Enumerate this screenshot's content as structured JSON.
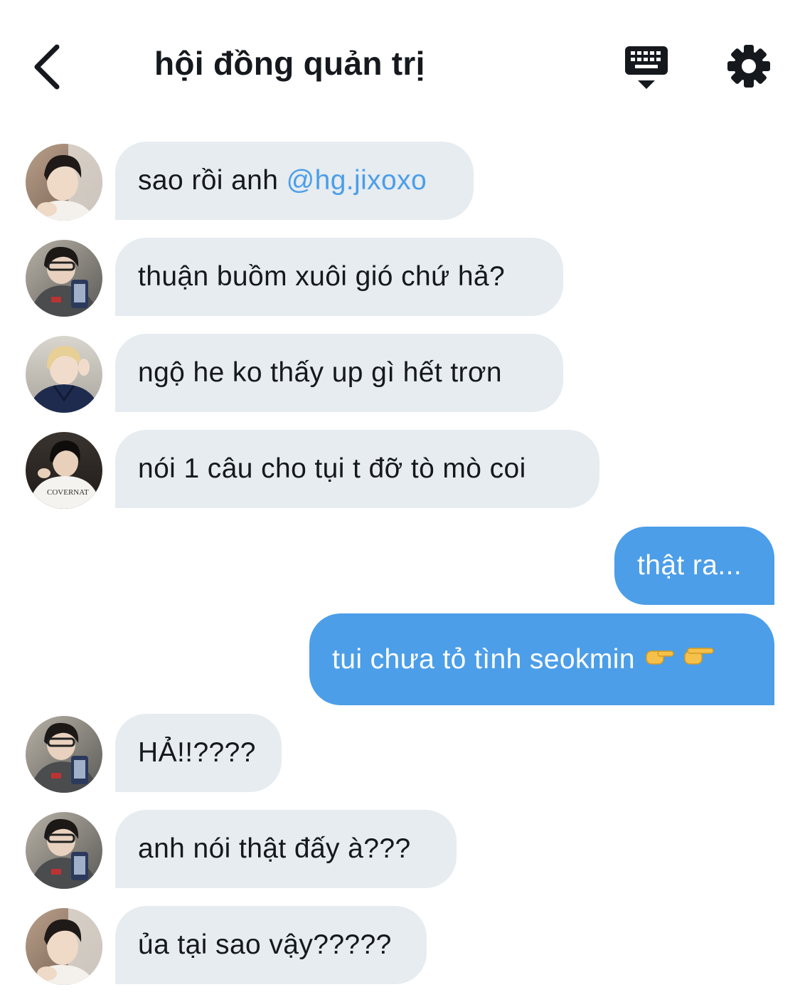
{
  "header": {
    "title": "hội đồng quản trị",
    "back_icon": "chevron-left-icon",
    "keyboard_icon": "keyboard-icon",
    "settings_icon": "gear-icon"
  },
  "colors": {
    "incoming_bubble": "#e6ecf0",
    "outgoing_bubble": "#4c9ee8",
    "mention": "#4c9ee8",
    "text": "#15191e"
  },
  "messages": [
    {
      "direction": "in",
      "avatar": "avatar-1",
      "text_prefix": "sao rồi anh ",
      "mention": "@hg.jixoxo"
    },
    {
      "direction": "in",
      "avatar": "avatar-2",
      "text": "thuận buồm xuôi gió chứ hả?"
    },
    {
      "direction": "in",
      "avatar": "avatar-3",
      "text": "ngộ he ko thấy up gì hết trơn"
    },
    {
      "direction": "in",
      "avatar": "avatar-4",
      "text": "nói 1 câu cho tụi t đỡ tò mò coi"
    },
    {
      "direction": "out",
      "text": "thật ra..."
    },
    {
      "direction": "out",
      "text": "tui chưa tỏ tình seokmin",
      "emoji": "pointing-hands-icons"
    },
    {
      "direction": "in",
      "avatar": "avatar-2",
      "text": "HẢ!!????"
    },
    {
      "direction": "in",
      "avatar": "avatar-2",
      "text": "anh nói thật đấy à???"
    },
    {
      "direction": "in",
      "avatar": "avatar-1",
      "text": "ủa tại sao vậy?????"
    }
  ]
}
